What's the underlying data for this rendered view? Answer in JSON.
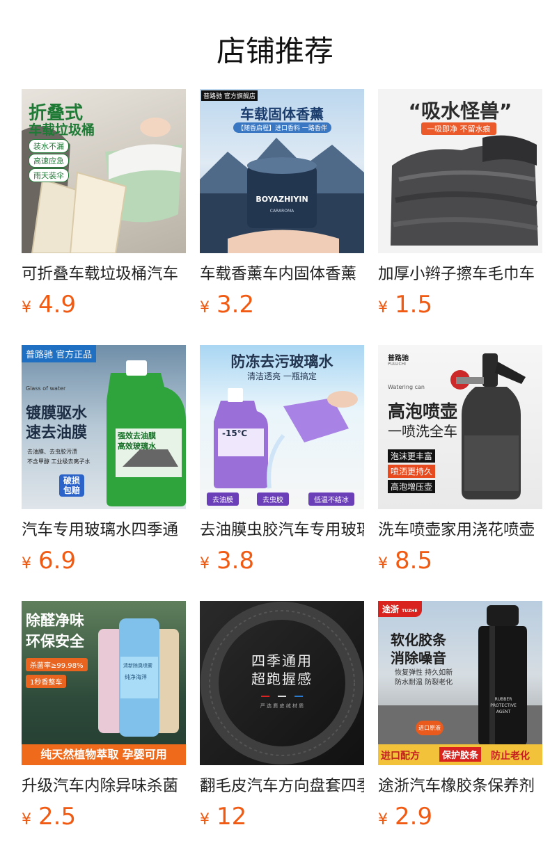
{
  "section_title": "店铺推荐",
  "currency": "¥",
  "products": [
    {
      "name": "可折叠车载垃圾桶汽车",
      "price": "4.9",
      "image_text": {
        "title": "折叠式",
        "title2": "车载垃圾桶",
        "tags": [
          "装水不漏",
          "高速应急",
          "雨天装伞"
        ]
      }
    },
    {
      "name": "车载香薰车内固体香薰",
      "price": "3.2",
      "image_text": {
        "badge": "普路驰",
        "store": "官方旗舰店",
        "title": "车载固体香薰",
        "sub": "【随香启程】进口香料 一路香伴",
        "brand": "BOYAZHIYIN",
        "brand_sub": "CARAROMA"
      }
    },
    {
      "name": "加厚小辫子擦车毛巾车",
      "price": "1.5",
      "image_text": {
        "title": "“吸水怪兽”",
        "sub": "一吸即净 不留水痕"
      }
    },
    {
      "name": "汽车专用玻璃水四季通",
      "price": "6.9",
      "image_text": {
        "badge": "普路驰",
        "badge2": "官方正品",
        "small": "Glass of water",
        "title": "镀膜驱水",
        "title2": "速去油膜",
        "bullets": [
          "去油膜、去虫胶污渍",
          "不含甲醇 工业级去离子水"
        ],
        "bottle1": "强效去油膜",
        "bottle2": "高效玻璃水",
        "stamp": "破损包赔"
      }
    },
    {
      "name": "去油膜虫胶汽车专用玻璃水",
      "price": "3.8",
      "image_text": {
        "title": "防冻去污玻璃水",
        "sub": "清洁透亮 一瓶搞定",
        "temp": "-15℃",
        "tags": [
          "去油膜",
          "去虫胶",
          "低温不结冰"
        ]
      }
    },
    {
      "name": "洗车喷壶家用浇花喷壶",
      "price": "8.5",
      "image_text": {
        "badge": "普路驰",
        "badge_en": "PULUCHI",
        "small": "Watering can",
        "title": "高泡喷壶",
        "title2": "一喷洗全车",
        "tags": [
          "泡沫更丰富",
          "喷洒更持久",
          "高泡增压壶"
        ]
      }
    },
    {
      "name": "升级汽车内除异味杀菌",
      "price": "2.5",
      "image_text": {
        "title": "除醛净味",
        "title2": "环保安全",
        "tag1": "杀菌率≥99.98%",
        "tag2": "1秒香整车",
        "bottom": "纯天然植物萃取 孕婴可用",
        "can_label": "清新除臭喷雾",
        "can_sub": "纯净海洋"
      }
    },
    {
      "name": "翻毛皮汽车方向盘套四季",
      "price": "12",
      "image_text": {
        "title": "四季通用",
        "title2": "超跑握感",
        "small": "严 选 麂 皮 绒 材 质"
      }
    },
    {
      "name": "途浙汽车橡胶条保养剂",
      "price": "2.9",
      "image_text": {
        "badge": "途浙",
        "badge_en": "TUZHE",
        "title": "软化胶条",
        "title2": "消除噪音",
        "sub1": "恢复弹性 持久如新",
        "sub2": "防水耐温 防裂老化",
        "label1": "RUBBER",
        "label2": "PROTECTIVE",
        "label3": "AGENT",
        "stamp": "进口原液",
        "bottom": [
          "进口配方",
          "保护胶条",
          "防止老化"
        ]
      }
    }
  ]
}
